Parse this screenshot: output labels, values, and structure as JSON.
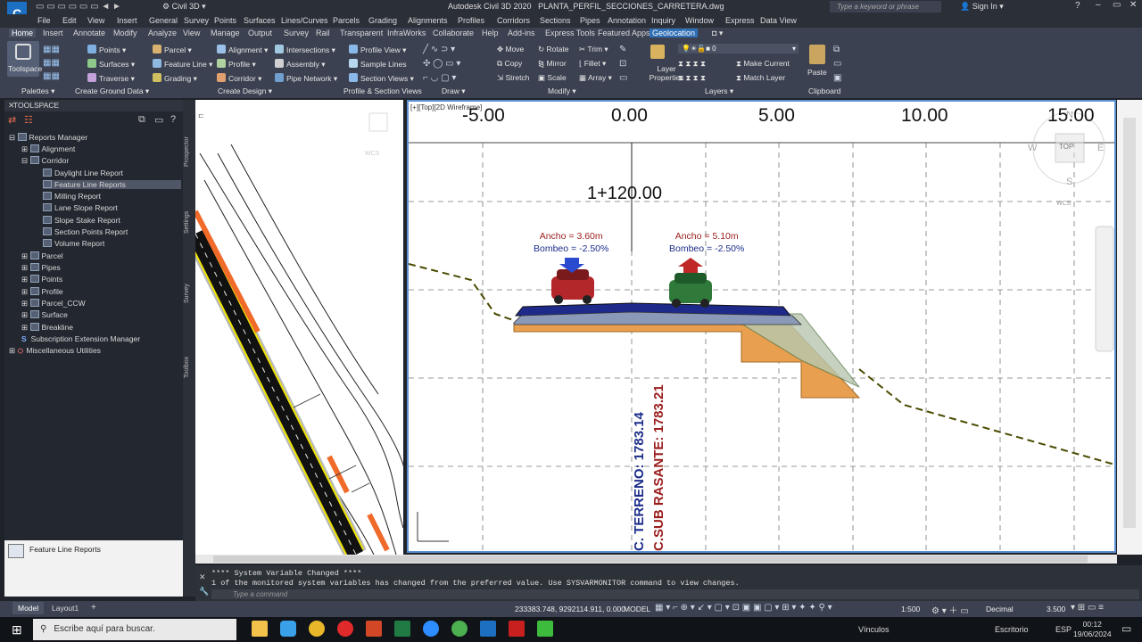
{
  "titlebar": {
    "app_title": "Autodesk Civil 3D 2020",
    "file_name": "PLANTA_PERFIL_SECCIONES_CARRETERA.dwg",
    "workspace": "Civil 3D",
    "search_placeholder": "Type a keyword or phrase",
    "sign_in": "Sign In"
  },
  "menu": [
    "File",
    "Edit",
    "View",
    "Insert",
    "General",
    "Survey",
    "Points",
    "Surfaces",
    "Lines/Curves",
    "Parcels",
    "Grading",
    "Alignments",
    "Profiles",
    "Corridors",
    "Sections",
    "Pipes",
    "Annotation",
    "Inquiry",
    "Window",
    "Express",
    "Data View"
  ],
  "tabs": [
    "Home",
    "Insert",
    "Annotate",
    "Modify",
    "Analyze",
    "View",
    "Manage",
    "Output",
    "Survey",
    "Rail",
    "Transparent",
    "InfraWorks",
    "Collaborate",
    "Help",
    "Add-ins",
    "Express Tools",
    "Featured Apps",
    "Geolocation"
  ],
  "ribbon": {
    "toolspace": "Toolspace",
    "palettes": "Palettes",
    "create_ground": [
      "Points",
      "Surfaces",
      "Traverse"
    ],
    "create_ground_title": "Create Ground Data",
    "create_design_a": [
      "Parcel",
      "Feature Line",
      "Grading"
    ],
    "create_design_b": [
      "Alignment",
      "Profile",
      "Corridor"
    ],
    "create_design_c": [
      "Intersections",
      "Assembly",
      "Pipe Network"
    ],
    "create_design_title": "Create Design",
    "profile_section": [
      "Profile View",
      "Sample Lines",
      "Section Views"
    ],
    "profile_section_title": "Profile & Section Views",
    "draw_title": "Draw",
    "modify_a": [
      "Move",
      "Copy",
      "Stretch"
    ],
    "modify_b": [
      "Rotate",
      "Mirror",
      "Scale"
    ],
    "modify_c": [
      "Trim",
      "Fillet",
      "Array"
    ],
    "modify_title": "Modify",
    "layer_properties": "Layer Properties",
    "layer_current": "0",
    "make_current": "Make Current",
    "match_layer": "Match Layer",
    "layers_title": "Layers",
    "paste": "Paste",
    "clipboard_title": "Clipboard"
  },
  "toolspace": {
    "title": "TOOLSPACE",
    "tree": [
      {
        "label": "Reports Manager",
        "expander": "⊟"
      },
      {
        "label": "Alignment",
        "expander": "⊞"
      },
      {
        "label": "Corridor",
        "expander": "⊟"
      },
      {
        "label": "Daylight Line Report",
        "expander": ""
      },
      {
        "label": "Feature Line Reports",
        "expander": ""
      },
      {
        "label": "Milling Report",
        "expander": ""
      },
      {
        "label": "Lane Slope Report",
        "expander": ""
      },
      {
        "label": "Slope Stake Report",
        "expander": ""
      },
      {
        "label": "Section Points Report",
        "expander": ""
      },
      {
        "label": "Volume Report",
        "expander": ""
      },
      {
        "label": "Parcel",
        "expander": "⊞"
      },
      {
        "label": "Pipes",
        "expander": "⊞"
      },
      {
        "label": "Points",
        "expander": "⊞"
      },
      {
        "label": "Profile",
        "expander": "⊞"
      },
      {
        "label": "Parcel_CCW",
        "expander": "⊞"
      },
      {
        "label": "Surface",
        "expander": "⊞"
      },
      {
        "label": "Breakline",
        "expander": "⊞"
      },
      {
        "label": "Subscription Extension Manager",
        "expander": ""
      },
      {
        "label": "Miscellaneous Utilities",
        "expander": "⊞"
      }
    ],
    "footer_label": "Feature Line Reports",
    "side_tabs": [
      "Prospector",
      "Settings",
      "Survey",
      "Toolbox"
    ]
  },
  "plan_view": {
    "label": "[-][Top][2D Wireframe]",
    "wcs": "WCS"
  },
  "section_view": {
    "viewport_label": "[+][Top][2D Wireframe]",
    "station": "1+120.00",
    "x_ticks": [
      "-5.00",
      "0.00",
      "5.00",
      "10.00",
      "15.00"
    ],
    "left_lane": {
      "width": "Ancho = 3.60m",
      "slope": "Bombeo = -2.50%"
    },
    "right_lane": {
      "width": "Ancho = 5.10m",
      "slope": "Bombeo = -2.50%"
    },
    "terrain_label": "C. TERRENO: 1783.14",
    "subgrade_label": "C.SUB RASANTE: 1783.21",
    "viewcube": {
      "top": "TOP",
      "n": "N",
      "s": "S",
      "e": "E",
      "w": "W",
      "wcs": "WCS"
    }
  },
  "command": {
    "line1": "**** System Variable Changed ****",
    "line2": "1 of the monitored system variables has changed from the preferred value. Use SYSVARMONITOR command to view changes.",
    "placeholder": "Type a command"
  },
  "status": {
    "tabs": [
      "Model",
      "Layout1"
    ],
    "coords": "233383.748, 9292114.911, 0.000",
    "mode": "MODEL",
    "scale": "1:500",
    "units": "Decimal",
    "lineweight": "3.500"
  },
  "taskbar": {
    "search_placeholder": "Escribe aquí para buscar.",
    "links": "Vínculos",
    "desktop": "Escritorio",
    "lang": "ESP",
    "time": "00:12",
    "date": "19/06/2024"
  }
}
